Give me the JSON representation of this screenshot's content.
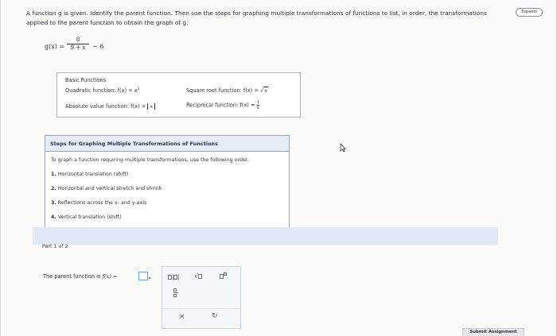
{
  "problem": {
    "line1": "A function g is given. Identify the parent function. Then use the steps for graphing multiple transformations of functions to list, in order, the transformations",
    "line2": "applied to the parent function to obtain the graph of g."
  },
  "language_button": "Español",
  "g_function": {
    "lhs": "g(x) =",
    "numerator": "8",
    "denominator": "9 + x",
    "rest": "− 6"
  },
  "basic_functions": {
    "title": "Basic Functions",
    "quadratic": "Quadratic function: f(x) = x",
    "quadratic_exp": "2",
    "absolute": "Absolute value function: f(x) = ",
    "absolute_var": "x",
    "square_root": "Square root function: f(x) = ",
    "square_root_var": "x",
    "reciprocal": "Reciprocal function: f(x) = ",
    "reciprocal_num": "1",
    "reciprocal_den": "x"
  },
  "steps": {
    "title": "Steps for Graphing Multiple Transformations of Functions",
    "intro": "To graph a function requiring multiple transformations, use the following order.",
    "items": [
      {
        "num": "1.",
        "text": "Horizontal translation (shift)"
      },
      {
        "num": "2.",
        "text": "Horizontal and vertical stretch and shrink"
      },
      {
        "num": "3.",
        "text": "Reflections across the x- and y-axis"
      },
      {
        "num": "4.",
        "text": "Vertical translation (shift)"
      }
    ]
  },
  "part": "Part 1 of 2",
  "question": {
    "prefix": "The parent function is ",
    "math": "f(x) =",
    "answer_value": ""
  },
  "keypad": {
    "keys": [
      "absolute-value",
      "square-root",
      "superscript",
      "fraction",
      "clear",
      "undo"
    ]
  },
  "submit_button": "Submit Assignment"
}
